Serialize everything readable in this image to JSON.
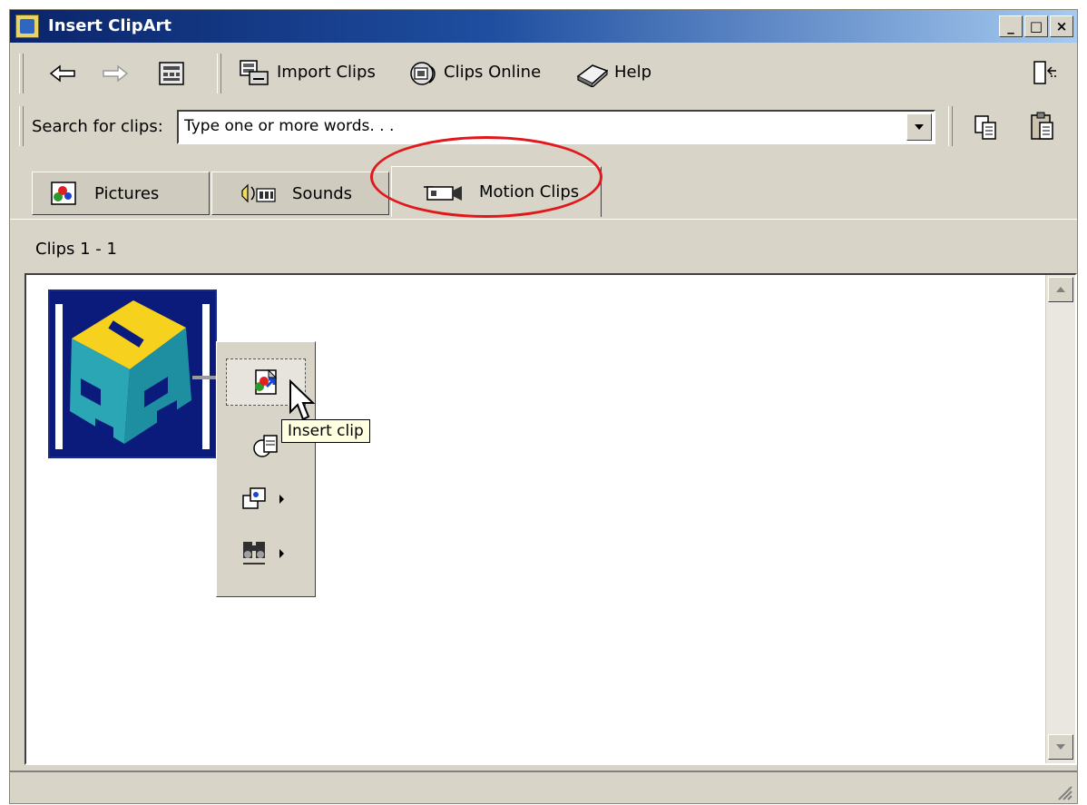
{
  "window": {
    "title": "Insert ClipArt"
  },
  "toolbar": {
    "back_icon": "back-arrow-icon",
    "forward_icon": "forward-arrow-icon",
    "view_icon": "all-categories-icon",
    "import_label": "Import Clips",
    "online_label": "Clips Online",
    "help_label": "Help",
    "change_view_icon": "change-view-icon"
  },
  "search": {
    "label": "Search for clips:",
    "value": "Type one or more words. . ."
  },
  "tabs": [
    {
      "label": "Pictures",
      "icon": "pictures-icon"
    },
    {
      "label": "Sounds",
      "icon": "sounds-icon"
    },
    {
      "label": "Motion Clips",
      "icon": "motion-clips-icon",
      "active": true
    }
  ],
  "results": {
    "count_label": "Clips 1 - 1"
  },
  "popup": {
    "items": [
      "insert-clip-icon",
      "preview-clip-icon",
      "add-to-favorites-icon",
      "find-similar-icon"
    ],
    "tooltip": "Insert clip"
  },
  "colors": {
    "highlight_circle": "#e0181c",
    "title_bar": "#0a246a"
  }
}
